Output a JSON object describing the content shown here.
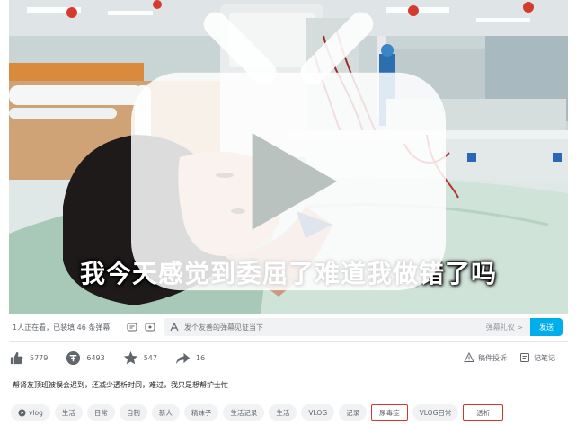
{
  "video": {
    "subtitle": "我今天感觉到委屈了难道我做错了吗"
  },
  "danmaku": {
    "viewer_info": "1人正在看，已装填 46 条弹幕",
    "input_placeholder": "发个友善的弹幕见证当下",
    "etiquette_label": "弹幕礼仪 >",
    "send_label": "发送"
  },
  "actions": {
    "like_count": "5779",
    "coin_count": "6493",
    "favorite_count": "547",
    "share_count": "16",
    "report_label": "稿件投诉",
    "notes_label": "记笔记"
  },
  "description": "帮肾友顶班被误会迟到，还减少透析时间，难过，我只是想帮护士忙",
  "tags": [
    {
      "label": "vlog",
      "icon": "vlog-icon",
      "highlighted": false
    },
    {
      "label": "生活",
      "highlighted": false
    },
    {
      "label": "日常",
      "highlighted": false
    },
    {
      "label": "自制",
      "highlighted": false
    },
    {
      "label": "新人",
      "highlighted": false
    },
    {
      "label": "精妹子",
      "highlighted": false
    },
    {
      "label": "生活记录",
      "highlighted": false
    },
    {
      "label": "生活",
      "highlighted": false
    },
    {
      "label": "VLOG",
      "highlighted": false
    },
    {
      "label": "记录",
      "highlighted": false
    },
    {
      "label": "尿毒症",
      "highlighted": true
    },
    {
      "label": "VLOG日常",
      "highlighted": false
    },
    {
      "label": "透析",
      "highlighted": true
    }
  ],
  "colors": {
    "accent": "#00aeec",
    "highlight_border": "#d9342b"
  }
}
